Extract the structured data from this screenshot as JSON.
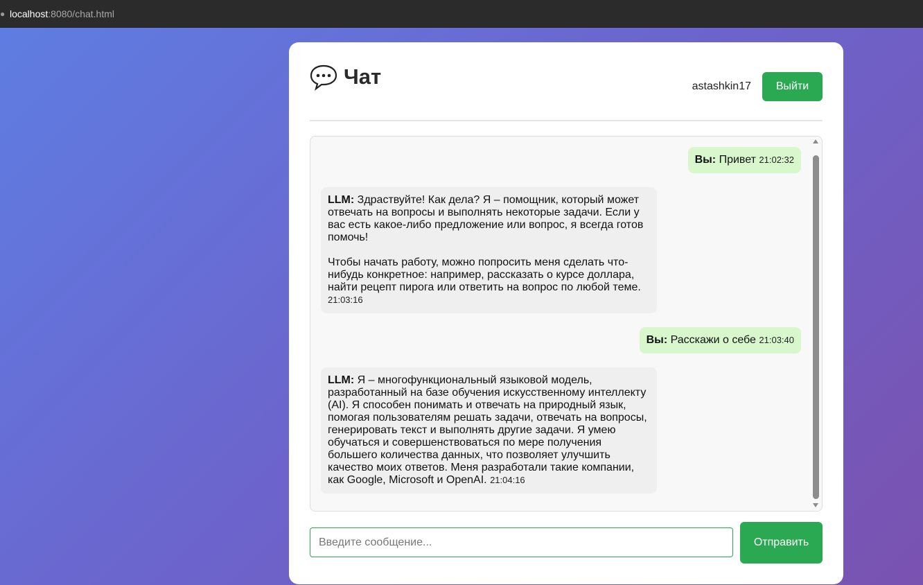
{
  "browser": {
    "url_host": "localhost",
    "url_rest": ":8080/chat.html"
  },
  "header": {
    "title": "Чат",
    "icon": "speech-balloon-icon",
    "username": "astashkin17",
    "logout_label": "Выйти"
  },
  "messages": [
    {
      "role": "user",
      "author": "Вы:",
      "text": "Привет",
      "time": "21:02:32"
    },
    {
      "role": "llm",
      "author": "LLM:",
      "text": "Здраствуйте! Как дела? Я – помощник, который может отвечать на вопросы и выполнять некоторые задачи. Если у вас есть какое-либо предложение или вопрос, я всегда готов помочь!\n\nЧтобы начать работу, можно попросить меня сделать что-нибудь конкретное: например, рассказать о курсе доллара, найти рецепт пирога или ответить на вопрос по любой теме.",
      "time": "21:03:16"
    },
    {
      "role": "user",
      "author": "Вы:",
      "text": "Расскажи о себе",
      "time": "21:03:40"
    },
    {
      "role": "llm",
      "author": "LLM:",
      "text": "Я – многофункциональный языковой модель, разработанный на базе обучения искусственному интеллекту (AI). Я способен понимать и отвечать на природный язык, помогая пользователям решать задачи, отвечать на вопросы, генерировать текст и выполнять другие задачи. Я умею обучаться и совершенствоваться по мере получения большего количества данных, что позволяет улучшить качество моих ответов. Меня разработали такие компании, как Google, Microsoft и OpenAI.",
      "time": "21:04:16"
    }
  ],
  "composer": {
    "placeholder": "Введите сообщение...",
    "value": "",
    "send_label": "Отправить"
  },
  "colors": {
    "accent": "#2aa952",
    "user_bubble": "#d8f7cc",
    "llm_bubble": "#efefef"
  }
}
